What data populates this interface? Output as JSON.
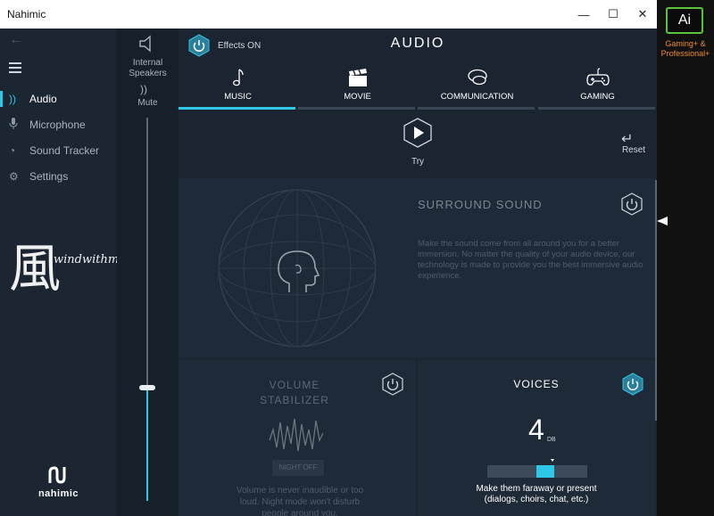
{
  "window": {
    "title": "Nahimic",
    "minimize": "—",
    "maximize": "☐",
    "close": "✕"
  },
  "sidebar": {
    "back_glyph": "←",
    "items": [
      {
        "label": "Audio",
        "icon": "audio-waves-icon",
        "glyph": "))",
        "active": true
      },
      {
        "label": "Microphone",
        "icon": "microphone-icon",
        "glyph": "🎙",
        "active": false
      },
      {
        "label": "Sound Tracker",
        "icon": "sound-tracker-icon",
        "glyph": "◔",
        "active": false
      },
      {
        "label": "Settings",
        "icon": "gear-icon",
        "glyph": "⚙",
        "active": false
      }
    ],
    "watermark_char": "風",
    "watermark_text": "windwithme",
    "brand": "nahimic"
  },
  "device": {
    "label_line1": "Internal",
    "label_line2": "Speakers",
    "mute_glyph": "))",
    "mute_label": "Mute",
    "volume_fraction": 0.29
  },
  "header": {
    "effects_label": "Effects ON",
    "title": "AUDIO"
  },
  "tabs": [
    {
      "label": "MUSIC",
      "icon": "music-note-icon",
      "active": true
    },
    {
      "label": "MOVIE",
      "icon": "clapperboard-icon",
      "active": false
    },
    {
      "label": "COMMUNICATION",
      "icon": "chat-bubbles-icon",
      "active": false
    },
    {
      "label": "GAMING",
      "icon": "gamepad-icon",
      "active": false
    }
  ],
  "try": {
    "label": "Try"
  },
  "reset": {
    "label": "Reset",
    "glyph": "↵"
  },
  "surround": {
    "title": "SURROUND SOUND",
    "description": "Make the sound come from all around you for a better immersion. No matter the quality of your audio device, our technology is made to provide you the best immersive audio experience.",
    "enabled": false
  },
  "stabilizer": {
    "title_line1": "VOLUME",
    "title_line2": "STABILIZER",
    "night_label": "NIGHT OFF",
    "description": "Volume is never inaudible or too loud. Night mode won't disturb people around you.",
    "enabled": false
  },
  "voices": {
    "title": "VOICES",
    "value": "4",
    "unit": "DB",
    "description_line1": "Make them faraway or present",
    "description_line2": "(dialogs, choirs, chat, etc.)",
    "enabled": true,
    "level_fraction": 0.6
  },
  "overlay": {
    "badge": "Ai",
    "caption_line1": "Gaming+ &",
    "caption_line2": "Professional+"
  },
  "colors": {
    "accent": "#2ec7e6",
    "badge_border": "#5cc23a",
    "caption": "#f08a2c"
  }
}
